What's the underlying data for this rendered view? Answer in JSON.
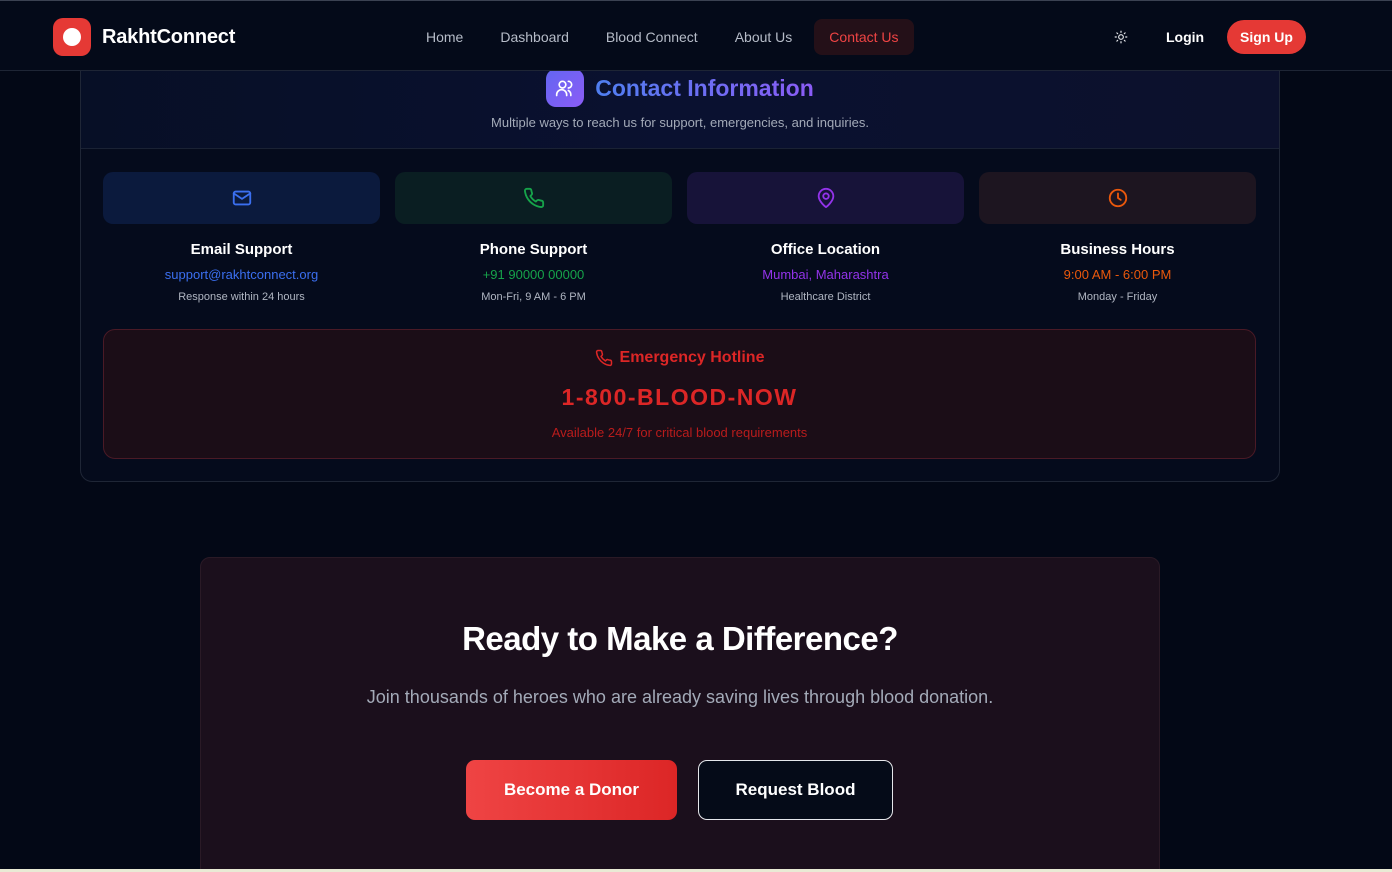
{
  "nav": {
    "brand": "RakhtConnect",
    "links": [
      "Home",
      "Dashboard",
      "Blood Connect",
      "About Us",
      "Contact Us"
    ],
    "active_link": "Contact Us",
    "theme_icon": "sun-icon",
    "login": "Login",
    "signup": "Sign Up"
  },
  "contact": {
    "title": "Contact Information",
    "subtitle": "Multiple ways to reach us for support, emergencies, and inquiries.",
    "items": [
      {
        "icon": "mail-icon",
        "title": "Email Support",
        "value": "support@rakhtconnect.org",
        "note": "Response within 24 hours",
        "accent": "#3b6ff0",
        "box": "#0b1a3d"
      },
      {
        "icon": "phone-icon",
        "title": "Phone Support",
        "value": "+91 90000 00000",
        "note": "Mon-Fri, 9 AM - 6 PM",
        "accent": "#16a34a",
        "box": "#0a1e22"
      },
      {
        "icon": "map-pin-icon",
        "title": "Office Location",
        "value": "Mumbai, Maharashtra",
        "note": "Healthcare District",
        "accent": "#9333ea",
        "box": "#171339"
      },
      {
        "icon": "clock-icon",
        "title": "Business Hours",
        "value": "9:00 AM - 6:00 PM",
        "note": "Monday - Friday",
        "accent": "#ea580c",
        "box": "#1d1520"
      }
    ],
    "emergency": {
      "title": "Emergency Hotline",
      "number": "1-800-BLOOD-NOW",
      "note": "Available 24/7 for critical blood requirements"
    }
  },
  "cta": {
    "title": "Ready to Make a Difference?",
    "text": "Join thousands of heroes who are already saving lives through blood donation.",
    "primary": "Become a Donor",
    "secondary": "Request Blood"
  }
}
